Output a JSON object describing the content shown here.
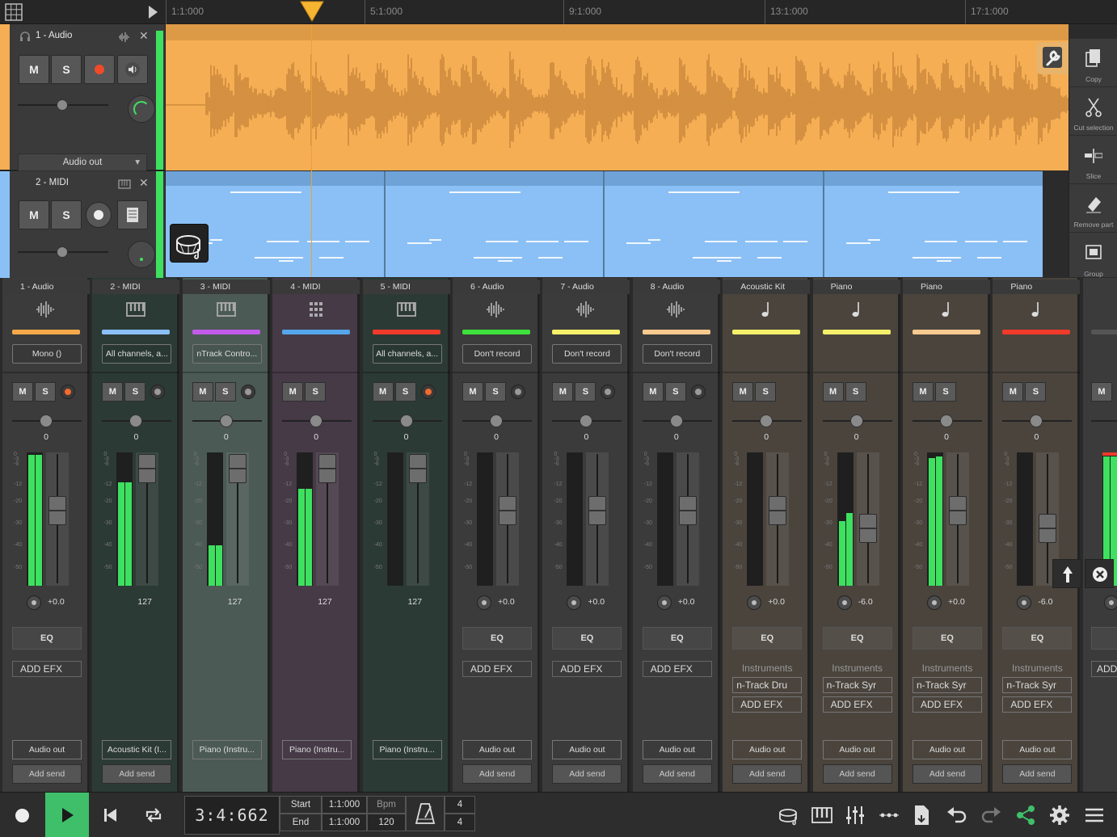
{
  "ruler": {
    "marks": [
      "1:1:000",
      "5:1:000",
      "9:1:000",
      "13:1:000",
      "17:1:000"
    ]
  },
  "tracks": [
    {
      "name": "1 - Audio",
      "color": "#f5ae53",
      "output": "Audio out",
      "mute": "M",
      "solo": "S"
    },
    {
      "name": "2 - MIDI",
      "color": "#8ac0f6",
      "mute": "M",
      "solo": "S"
    }
  ],
  "tools": [
    {
      "label": "Copy",
      "icon": "copy-icon"
    },
    {
      "label": "Cut selection",
      "icon": "scissors-icon"
    },
    {
      "label": "Slice",
      "icon": "slice-icon"
    },
    {
      "label": "Remove part",
      "icon": "eraser-icon"
    },
    {
      "label": "Group",
      "icon": "group-icon"
    }
  ],
  "mixer": {
    "strips": [
      {
        "name": "1 - Audio",
        "icon": "waveform-icon",
        "color": "#f7a94a",
        "bg": "#3b3b3b",
        "input": "Mono ()",
        "mute": "M",
        "solo": "S",
        "rec": "on",
        "pan": "0",
        "volume": "+0.0",
        "eq": "EQ",
        "efx": "ADD EFX",
        "output": "Audio out",
        "send": "Add send"
      },
      {
        "name": "2 - MIDI",
        "icon": "keyboard-icon",
        "color": "#8ac0f6",
        "bg": "#2c3a35",
        "input": "All channels, a...",
        "mute": "M",
        "solo": "S",
        "rec": "off",
        "pan": "0",
        "volume": "127",
        "output": "Acoustic Kit (I...",
        "send": "Add send"
      },
      {
        "name": "3 - MIDI",
        "icon": "keyboard-icon",
        "color": "#c25bea",
        "bg": "#4b5a55",
        "input": "nTrack Contro...",
        "mute": "M",
        "solo": "S",
        "rec": "off",
        "pan": "0",
        "volume": "127",
        "output": "Piano (Instru...",
        "send": ""
      },
      {
        "name": "4 - MIDI",
        "icon": "pads-icon",
        "color": "#55a6ea",
        "bg": "#463a47",
        "input": "",
        "mute": "M",
        "solo": "S",
        "rec": "none",
        "pan": "0",
        "volume": "127",
        "output": "Piano (Instru...",
        "send": ""
      },
      {
        "name": "5 - MIDI",
        "icon": "keyboard-icon",
        "color": "#f03a2a",
        "bg": "#2c3a35",
        "input": "All channels, a...",
        "mute": "M",
        "solo": "S",
        "rec": "on",
        "pan": "0",
        "volume": "127",
        "output": "Piano (Instru...",
        "send": ""
      },
      {
        "name": "6 - Audio",
        "icon": "waveform-icon",
        "color": "#3ee03e",
        "bg": "#3b3b3b",
        "input": "Don't record",
        "mute": "M",
        "solo": "S",
        "rec": "off",
        "pan": "0",
        "volume": "+0.0",
        "eq": "EQ",
        "efx": "ADD EFX",
        "output": "Audio out",
        "send": "Add send"
      },
      {
        "name": "7 - Audio",
        "icon": "waveform-icon",
        "color": "#f4f06a",
        "bg": "#3b3b3b",
        "input": "Don't record",
        "mute": "M",
        "solo": "S",
        "rec": "off",
        "pan": "0",
        "volume": "+0.0",
        "eq": "EQ",
        "efx": "ADD EFX",
        "output": "Audio out",
        "send": "Add send"
      },
      {
        "name": "8 - Audio",
        "icon": "waveform-icon",
        "color": "#f7c98e",
        "bg": "#3b3b3b",
        "input": "Don't record",
        "mute": "M",
        "solo": "S",
        "rec": "off",
        "pan": "0",
        "volume": "+0.0",
        "eq": "EQ",
        "efx": "ADD EFX",
        "output": "Audio out",
        "send": "Add send"
      },
      {
        "name": "Acoustic Kit",
        "icon": "note-icon",
        "color": "#f4f06a",
        "bg": "#4a443d",
        "input": "",
        "mute": "M",
        "solo": "S",
        "rec": "none",
        "pan": "0",
        "volume": "+0.0",
        "eq": "EQ",
        "instr_label": "Instruments",
        "instr": "n-Track Dru",
        "efx": "ADD EFX",
        "output": "Audio out",
        "send": "Add send"
      },
      {
        "name": "Piano",
        "icon": "note-icon",
        "color": "#f4f06a",
        "bg": "#4a443d",
        "input": "",
        "mute": "M",
        "solo": "S",
        "rec": "none",
        "pan": "0",
        "volume": "-6.0",
        "eq": "EQ",
        "instr_label": "Instruments",
        "instr": "n-Track Syr",
        "efx": "ADD EFX",
        "output": "Audio out",
        "send": "Add send"
      },
      {
        "name": "Piano",
        "icon": "note-icon",
        "color": "#f7c98e",
        "bg": "#4a443d",
        "input": "",
        "mute": "M",
        "solo": "S",
        "rec": "none",
        "pan": "0",
        "volume": "+0.0",
        "eq": "EQ",
        "instr_label": "Instruments",
        "instr": "n-Track Syr",
        "efx": "ADD EFX",
        "output": "Audio out",
        "send": "Add send"
      },
      {
        "name": "Piano",
        "icon": "note-icon",
        "color": "#f03a2a",
        "bg": "#4a443d",
        "input": "",
        "mute": "M",
        "solo": "S",
        "rec": "none",
        "pan": "0",
        "volume": "-6.0",
        "eq": "EQ",
        "instr_label": "Instruments",
        "instr": "n-Track Syr",
        "efx": "ADD EFX",
        "output": "Audio out",
        "send": "Add send"
      }
    ],
    "partial": {
      "mute": "M",
      "efx": "ADD"
    },
    "scale": [
      "0",
      "-3",
      "-6",
      "-12",
      "-20",
      "-30",
      "-40",
      "-50"
    ]
  },
  "transport": {
    "time": "3:4:662",
    "start_label": "Start",
    "start_value": "1:1:000",
    "end_label": "End",
    "end_value": "1:1:000",
    "bpm_label": "Bpm",
    "bpm_value": "120",
    "sig_top": "4",
    "sig_bottom": "4"
  }
}
